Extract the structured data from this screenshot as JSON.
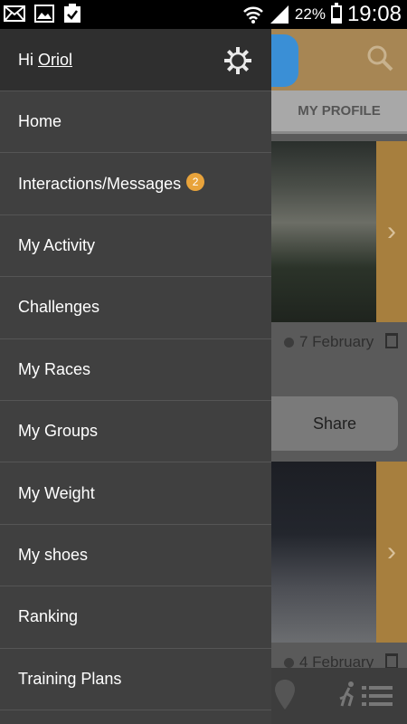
{
  "status_bar": {
    "battery": "22%",
    "time": "19:08",
    "icons": [
      "mail-icon",
      "image-icon",
      "clipboard-check-icon",
      "wifi-icon",
      "signal-icon",
      "battery-icon"
    ]
  },
  "drawer": {
    "greeting_prefix": "Hi ",
    "user_name": "Oriol",
    "items": [
      {
        "label": "Home"
      },
      {
        "label": "Interactions/Messages",
        "badge": "2"
      },
      {
        "label": "My Activity"
      },
      {
        "label": "Challenges"
      },
      {
        "label": "My Races"
      },
      {
        "label": "My Groups"
      },
      {
        "label": "My Weight"
      },
      {
        "label": "My shoes"
      },
      {
        "label": "Ranking"
      },
      {
        "label": "Training Plans"
      }
    ]
  },
  "background": {
    "tab_label": "MY PROFILE",
    "post1_date": "7 February",
    "share_label": "Share",
    "post2_date": "4 February"
  },
  "colors": {
    "drawer_bg": "#404040",
    "drawer_header_bg": "#2f2f2f",
    "badge": "#e8a33b",
    "accent": "#a77f3e"
  }
}
